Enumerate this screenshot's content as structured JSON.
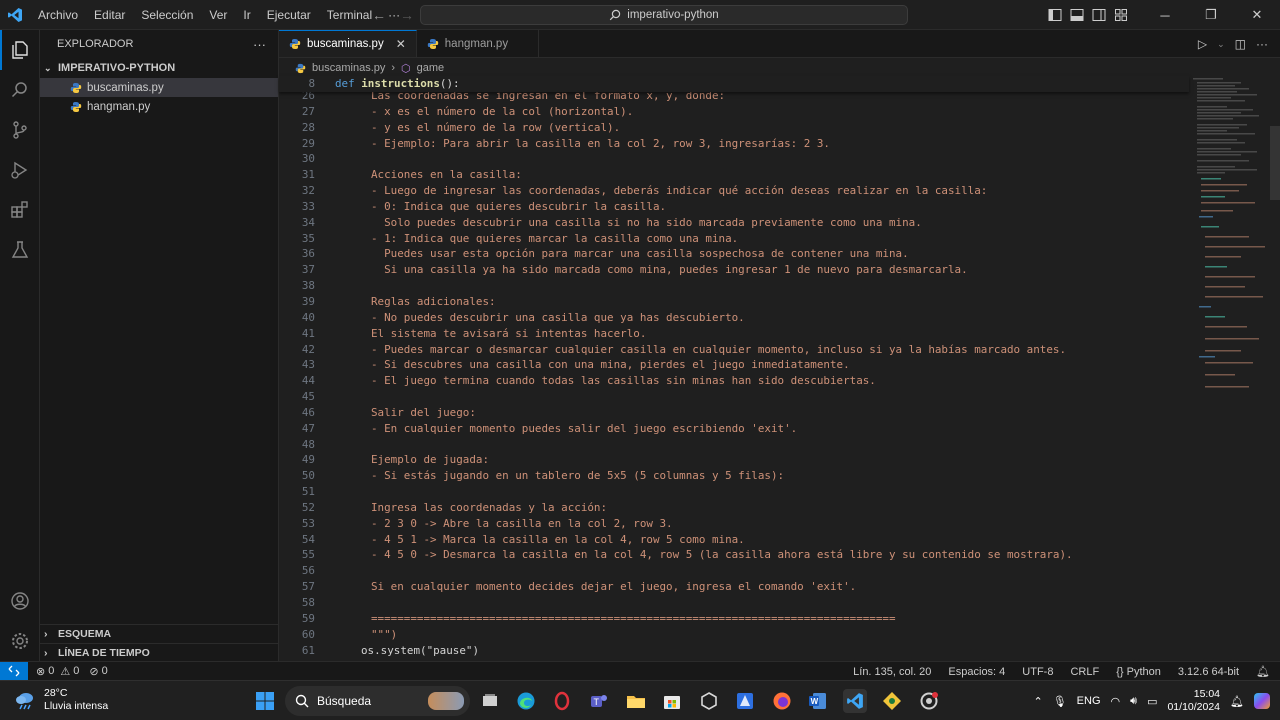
{
  "titlebar": {
    "menu": [
      "Archivo",
      "Editar",
      "Selección",
      "Ver",
      "Ir",
      "Ejecutar",
      "Terminal",
      "···"
    ],
    "search_text": "imperativo-python"
  },
  "sidebar": {
    "header": "EXPLORADOR",
    "more": "···",
    "folder": "IMPERATIVO-PYTHON",
    "files": [
      "buscaminas.py",
      "hangman.py"
    ],
    "outline": "ESQUEMA",
    "timeline": "LÍNEA DE TIEMPO"
  },
  "tabs": [
    {
      "label": "buscaminas.py"
    },
    {
      "label": "hangman.py"
    }
  ],
  "breadcrumb": {
    "file": "buscaminas.py",
    "separator": "›",
    "symbol": "game"
  },
  "sticky": {
    "line": "8",
    "kw": "def",
    "fn": "instructions",
    "rest": "():"
  },
  "code_lines": [
    {
      "n": "26",
      "t": "Las coordenadas se ingresan en el formato x, y, donde:"
    },
    {
      "n": "27",
      "t": "- x es el número de la col (horizontal)."
    },
    {
      "n": "28",
      "t": "- y es el número de la row (vertical)."
    },
    {
      "n": "29",
      "t": "- Ejemplo: Para abrir la casilla en la col 2, row 3, ingresarías: 2 3."
    },
    {
      "n": "30",
      "t": ""
    },
    {
      "n": "31",
      "t": "Acciones en la casilla:"
    },
    {
      "n": "32",
      "t": "- Luego de ingresar las coordenadas, deberás indicar qué acción deseas realizar en la casilla:"
    },
    {
      "n": "33",
      "t": "- 0: Indica que quieres descubrir la casilla."
    },
    {
      "n": "34",
      "t": "  Solo puedes descubrir una casilla si no ha sido marcada previamente como una mina."
    },
    {
      "n": "35",
      "t": "- 1: Indica que quieres marcar la casilla como una mina."
    },
    {
      "n": "36",
      "t": "  Puedes usar esta opción para marcar una casilla sospechosa de contener una mina."
    },
    {
      "n": "37",
      "t": "  Si una casilla ya ha sido marcada como mina, puedes ingresar 1 de nuevo para desmarcarla."
    },
    {
      "n": "38",
      "t": ""
    },
    {
      "n": "39",
      "t": "Reglas adicionales:"
    },
    {
      "n": "40",
      "t": "- No puedes descubrir una casilla que ya has descubierto."
    },
    {
      "n": "41",
      "t": "El sistema te avisará si intentas hacerlo."
    },
    {
      "n": "42",
      "t": "- Puedes marcar o desmarcar cualquier casilla en cualquier momento, incluso si ya la habías marcado antes."
    },
    {
      "n": "43",
      "t": "- Si descubres una casilla con una mina, pierdes el juego inmediatamente."
    },
    {
      "n": "44",
      "t": "- El juego termina cuando todas las casillas sin minas han sido descubiertas."
    },
    {
      "n": "45",
      "t": ""
    },
    {
      "n": "46",
      "t": "Salir del juego:"
    },
    {
      "n": "47",
      "t": "- En cualquier momento puedes salir del juego escribiendo 'exit'."
    },
    {
      "n": "48",
      "t": ""
    },
    {
      "n": "49",
      "t": "Ejemplo de jugada:"
    },
    {
      "n": "50",
      "t": "- Si estás jugando en un tablero de 5x5 (5 columnas y 5 filas):"
    },
    {
      "n": "51",
      "t": ""
    },
    {
      "n": "52",
      "t": "Ingresa las coordenadas y la acción:"
    },
    {
      "n": "53",
      "t": "- 2 3 0 -> Abre la casilla en la col 2, row 3."
    },
    {
      "n": "54",
      "t": "- 4 5 1 -> Marca la casilla en la col 4, row 5 como mina."
    },
    {
      "n": "55",
      "t": "- 4 5 0 -> Desmarca la casilla en la col 4, row 5 (la casilla ahora está libre y su contenido se mostrara)."
    },
    {
      "n": "56",
      "t": ""
    },
    {
      "n": "57",
      "t": "Si en cualquier momento decides dejar el juego, ingresa el comando 'exit'."
    },
    {
      "n": "58",
      "t": ""
    },
    {
      "n": "59",
      "t": "================================================================================"
    },
    {
      "n": "60",
      "t": "\"\"\")"
    },
    {
      "n": "61",
      "t": "os.system(\"pause\")"
    }
  ],
  "statusbar": {
    "problems": "0",
    "warnings": "0",
    "ports": "0",
    "position": "Lín. 135, col. 20",
    "spaces": "Espacios: 4",
    "encoding": "UTF-8",
    "eol": "CRLF",
    "language": "Python",
    "interpreter": "3.12.6 64-bit"
  },
  "taskbar": {
    "temperature": "28°C",
    "weather": "Lluvia intensa",
    "search": "Búsqueda",
    "lang": "ENG",
    "time": "15:04",
    "date": "01/10/2024"
  },
  "colors": {
    "accent": "#0078d4",
    "string": "#ce9178",
    "keyword": "#569cd6",
    "function": "#dcdcaa"
  }
}
